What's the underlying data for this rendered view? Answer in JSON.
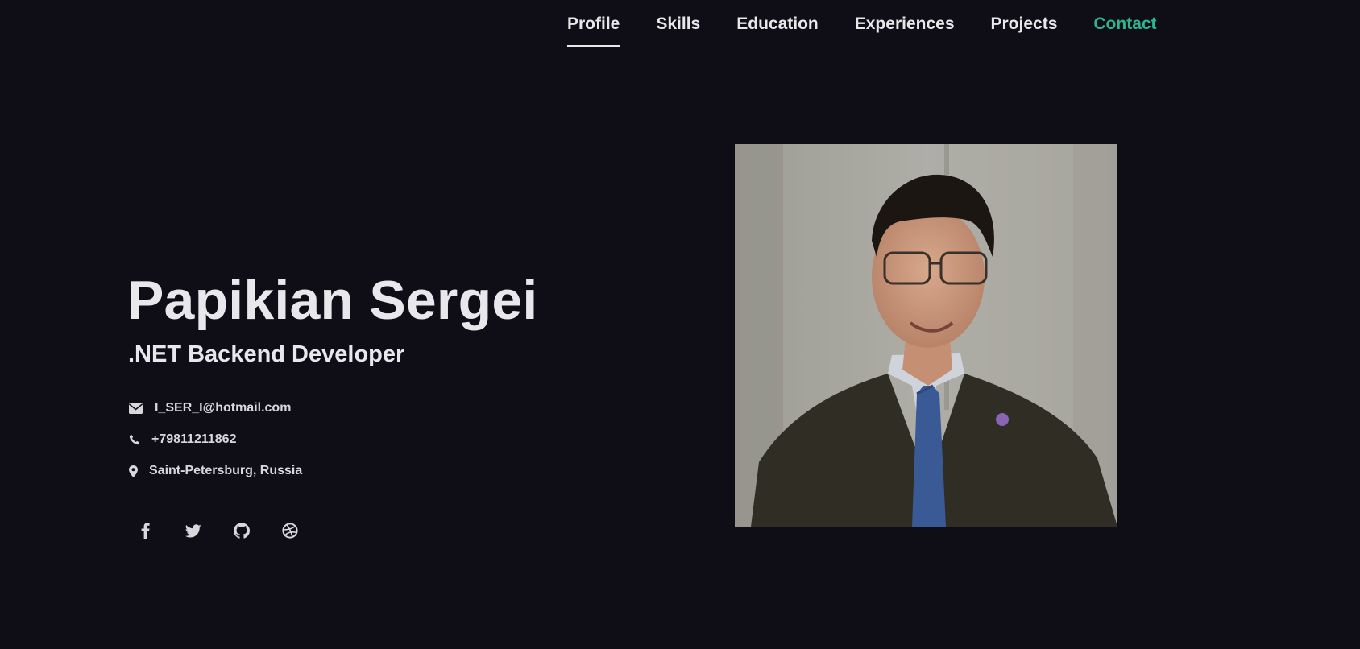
{
  "nav": {
    "items": [
      {
        "label": "Profile"
      },
      {
        "label": "Skills"
      },
      {
        "label": "Education"
      },
      {
        "label": "Experiences"
      },
      {
        "label": "Projects"
      },
      {
        "label": "Contact"
      }
    ],
    "active": "Profile"
  },
  "hero": {
    "name": "Papikian Sergei",
    "role": ".NET Backend Developer"
  },
  "contacts": {
    "email": "I_SER_I@hotmail.com",
    "phone": "+79811211862",
    "location": "Saint-Petersburg, Russia"
  },
  "socials": [
    {
      "icon": "facebook-icon"
    },
    {
      "icon": "twitter-icon"
    },
    {
      "icon": "github-icon"
    },
    {
      "icon": "dribbble-icon"
    }
  ],
  "colors": {
    "background": "#0f0e17",
    "text": "#e8e8ec",
    "accent": "#2cb592"
  }
}
